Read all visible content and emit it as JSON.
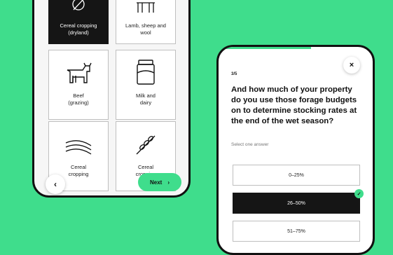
{
  "farm_types": [
    {
      "line1": "Cereal cropping",
      "line2": "(dryland)",
      "selected": true
    },
    {
      "line1": "Lamb, sheep and",
      "line2": "wool",
      "selected": false
    },
    {
      "line1": "Beef",
      "line2": "(grazing)",
      "selected": false
    },
    {
      "line1": "Milk and",
      "line2": "dairy",
      "selected": false
    },
    {
      "line1": "Cereal",
      "line2": "cropping",
      "selected": false
    },
    {
      "line1": "Cereal",
      "line2": "cropping",
      "selected": false
    }
  ],
  "nav": {
    "back_icon": "‹",
    "next_label": "Next",
    "next_icon": "›"
  },
  "question_screen": {
    "step": "3/5",
    "close_icon": "×",
    "question": "And how much of your property do you use those forage budgets on to determine stocking rates at the end of the wet season?",
    "hint": "Select one answer",
    "progress_fraction": 0.6,
    "options": [
      {
        "label": "0–25%",
        "selected": false
      },
      {
        "label": "26–50%",
        "selected": true
      },
      {
        "label": "51–75%",
        "selected": false
      }
    ]
  },
  "colors": {
    "background": "#3fdd8c",
    "accent": "#3fdd8c",
    "dark": "#151515"
  }
}
